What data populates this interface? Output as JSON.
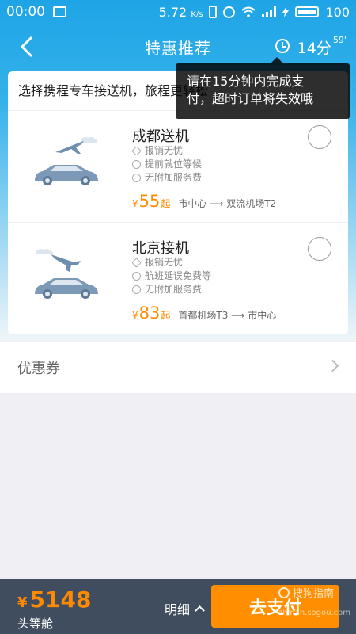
{
  "status_bar": {
    "time": "00:00",
    "speed": "5.72",
    "speed_unit": "K/s",
    "battery": "100"
  },
  "header": {
    "title": "特惠推荐",
    "timer_minutes": "14分",
    "timer_seconds": "59\""
  },
  "tooltip": {
    "line1": "请在15分钟内完成支",
    "line2": "付，超时订单将失效哦"
  },
  "card": {
    "intro": "选择携程专车接送机，旅程更轻松",
    "services": [
      {
        "name": "成都送机",
        "features": [
          "报销无忧",
          "提前就位等候",
          "无附加服务费"
        ],
        "currency": "¥",
        "price": "55",
        "price_suffix": "起",
        "route": "市中心 ⟶ 双流机场T2"
      },
      {
        "name": "北京接机",
        "features": [
          "报销无忧",
          "航班延误免费等",
          "无附加服务费"
        ],
        "currency": "¥",
        "price": "83",
        "price_suffix": "起",
        "route": "首都机场T3 ⟶ 市中心"
      }
    ]
  },
  "coupon": {
    "label": "优惠券"
  },
  "bottom_bar": {
    "currency": "¥",
    "total": "5148",
    "cabin": "头等舱",
    "detail_label": "明细",
    "pay_label": "去支付"
  },
  "watermark": {
    "name": "搜狗指南",
    "url": "zhinan.sogou.com"
  },
  "colors": {
    "accent": "#ff8a00",
    "header_blue": "#1ea4e6",
    "bottom_bar": "#3f4d5e"
  }
}
